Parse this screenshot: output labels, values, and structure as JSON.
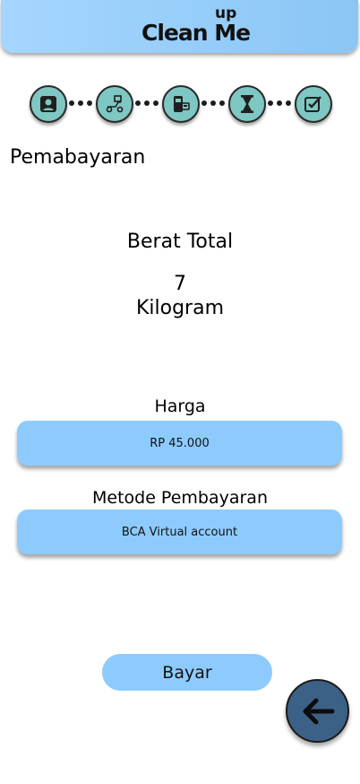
{
  "header": {
    "logo_main": "Clean Me",
    "logo_sup": "up"
  },
  "stepper": {
    "steps": [
      {
        "icon": "user-profile-icon"
      },
      {
        "icon": "scooter-delivery-icon"
      },
      {
        "icon": "payment-wallet-icon"
      },
      {
        "icon": "hourglass-icon"
      },
      {
        "icon": "checklist-icon"
      }
    ]
  },
  "page": {
    "title": "Pemabayaran"
  },
  "weight": {
    "label": "Berat Total",
    "value": "7",
    "unit": "Kilogram"
  },
  "price": {
    "label": "Harga",
    "value": "RP 45.000"
  },
  "payment_method": {
    "label": "Metode Pembayaran",
    "value": "BCA Virtual account"
  },
  "actions": {
    "pay_label": "Bayar"
  },
  "colors": {
    "header": "#8bc6f5",
    "field": "#8dcbff",
    "step": "#7ec7c2",
    "back_button": "#3c6186"
  }
}
